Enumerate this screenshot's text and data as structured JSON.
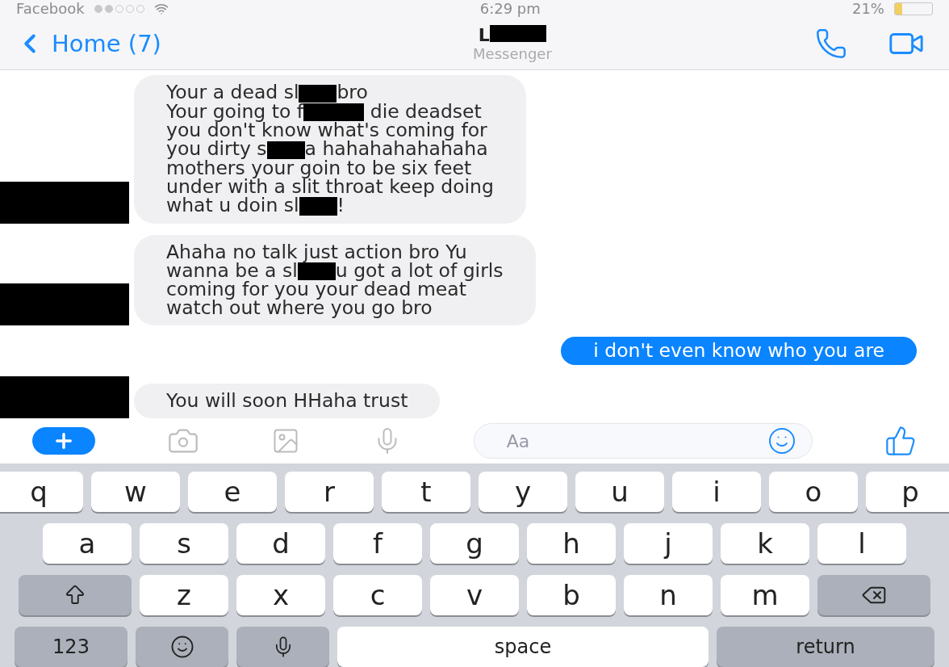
{
  "status_bar": {
    "carrier": "Facebook",
    "time": "6:29 pm",
    "battery": "21%"
  },
  "header": {
    "back": "Home (7)",
    "title": [
      {
        "kind": "text",
        "text": "L"
      },
      {
        "kind": "redaction",
        "wide": true
      }
    ],
    "subtitle": "Messenger"
  },
  "messages": [
    {
      "outgoing": false,
      "lines": [
        [
          {
            "kind": "text",
            "text": "Your a dead sl"
          },
          {
            "kind": "redaction",
            "wide": false
          },
          {
            "kind": "text",
            "text": "bro"
          }
        ],
        [
          {
            "kind": "text",
            "text": "Your going to f"
          },
          {
            "kind": "redaction",
            "wide": true
          },
          {
            "kind": "text",
            "text": " die deadset"
          }
        ],
        [
          {
            "kind": "text",
            "text": "you don't know what's coming for"
          }
        ],
        [
          {
            "kind": "text",
            "text": "you dirty s"
          },
          {
            "kind": "redaction",
            "wide": false
          },
          {
            "kind": "text",
            "text": "a hahahahahahaha"
          }
        ],
        [
          {
            "kind": "text",
            "text": "mothers your goin to be six feet"
          }
        ],
        [
          {
            "kind": "text",
            "text": "under with a slit throat keep doing"
          }
        ],
        [
          {
            "kind": "text",
            "text": "what u doin sl"
          },
          {
            "kind": "redaction",
            "wide": false
          },
          {
            "kind": "text",
            "text": "!"
          }
        ]
      ]
    },
    {
      "outgoing": false,
      "lines": [
        [
          {
            "kind": "text",
            "text": "Ahaha no talk just action bro Yu"
          }
        ],
        [
          {
            "kind": "text",
            "text": "wanna be a sl"
          },
          {
            "kind": "redaction",
            "wide": false
          },
          {
            "kind": "text",
            "text": "u got a lot of girls"
          }
        ],
        [
          {
            "kind": "text",
            "text": "coming for you your dead meat"
          }
        ],
        [
          {
            "kind": "text",
            "text": "watch out where you go bro"
          }
        ]
      ]
    },
    {
      "outgoing": true,
      "lines": [
        [
          {
            "kind": "text",
            "text": "i don't even know who you are"
          }
        ]
      ]
    },
    {
      "outgoing": false,
      "lines": [
        [
          {
            "kind": "text",
            "text": "You will soon HHaha trust"
          }
        ]
      ]
    }
  ],
  "composer": {
    "placeholder": "Aa"
  },
  "keyboard": [
    [
      {
        "kind": "letter",
        "label": "q"
      },
      {
        "kind": "letter",
        "label": "w"
      },
      {
        "kind": "letter",
        "label": "e"
      },
      {
        "kind": "letter",
        "label": "r"
      },
      {
        "kind": "letter",
        "label": "t"
      },
      {
        "kind": "letter",
        "label": "y"
      },
      {
        "kind": "letter",
        "label": "u"
      },
      {
        "kind": "letter",
        "label": "i"
      },
      {
        "kind": "letter",
        "label": "o"
      },
      {
        "kind": "letter",
        "label": "p"
      }
    ],
    [
      {
        "kind": "letter",
        "label": "a"
      },
      {
        "kind": "letter",
        "label": "s"
      },
      {
        "kind": "letter",
        "label": "d"
      },
      {
        "kind": "letter",
        "label": "f"
      },
      {
        "kind": "letter",
        "label": "g"
      },
      {
        "kind": "letter",
        "label": "h"
      },
      {
        "kind": "letter",
        "label": "j"
      },
      {
        "kind": "letter",
        "label": "k"
      },
      {
        "kind": "letter",
        "label": "l"
      }
    ],
    [
      {
        "kind": "shift"
      },
      {
        "kind": "letter",
        "label": "z"
      },
      {
        "kind": "letter",
        "label": "x"
      },
      {
        "kind": "letter",
        "label": "c"
      },
      {
        "kind": "letter",
        "label": "v"
      },
      {
        "kind": "letter",
        "label": "b"
      },
      {
        "kind": "letter",
        "label": "n"
      },
      {
        "kind": "letter",
        "label": "m"
      },
      {
        "kind": "backspace"
      }
    ],
    [
      {
        "kind": "mode",
        "label": "123"
      },
      {
        "kind": "emoji"
      },
      {
        "kind": "mic"
      },
      {
        "kind": "space",
        "label": "space"
      },
      {
        "kind": "return",
        "label": "return"
      }
    ]
  ]
}
